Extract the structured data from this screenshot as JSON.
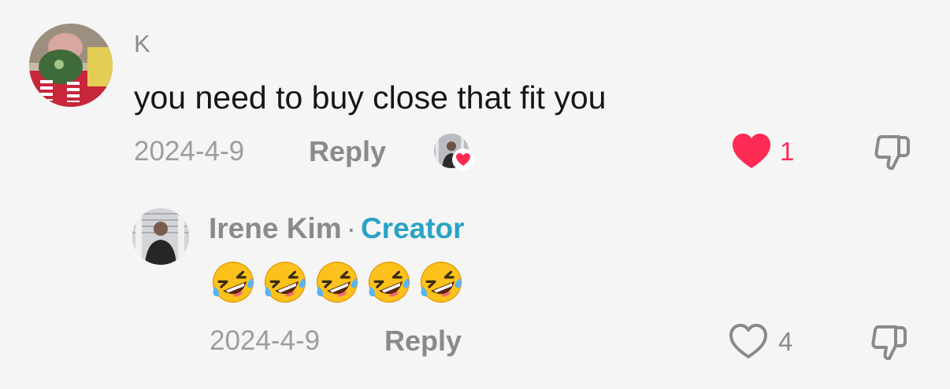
{
  "comment": {
    "username": "K",
    "avatar_icon": "user-avatar-plush-toy",
    "text": "you need to buy close that fit you",
    "date": "2024-4-9",
    "reply_label": "Reply",
    "liked_by_creator": true,
    "likes": {
      "count": "1",
      "liked": true,
      "color": "#fe2c55"
    },
    "dislike_icon": "thumbs-down-icon"
  },
  "reply": {
    "author": "Irene Kim",
    "separator": "·",
    "badge": "Creator",
    "badge_color": "#2aa3c5",
    "avatar_icon": "user-avatar-photo",
    "emojis": [
      "rolling-on-floor-laughing",
      "rolling-on-floor-laughing",
      "rolling-on-floor-laughing",
      "rolling-on-floor-laughing",
      "rolling-on-floor-laughing"
    ],
    "date": "2024-4-9",
    "reply_label": "Reply",
    "likes": {
      "count": "4",
      "liked": false
    },
    "dislike_icon": "thumbs-down-icon"
  }
}
